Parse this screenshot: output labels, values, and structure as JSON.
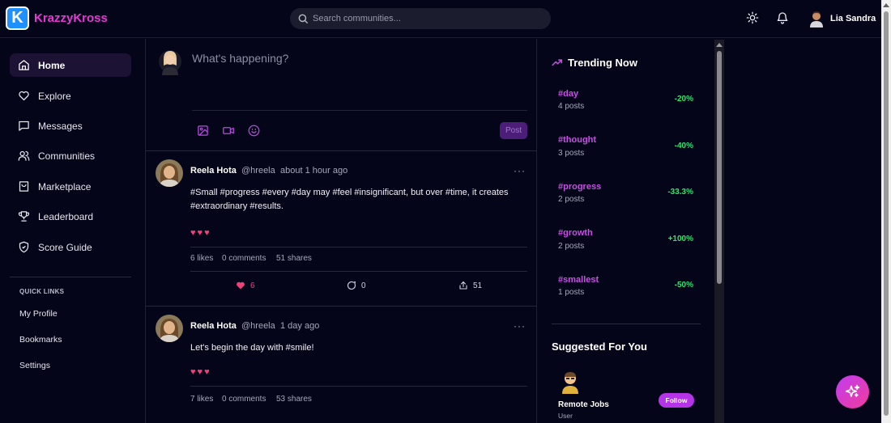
{
  "app": {
    "logo_letter": "K",
    "name": "KrazzyKross",
    "brand_color": "#e43ad4"
  },
  "search": {
    "placeholder": "Search communities..."
  },
  "header": {
    "user_name": "Lia Sandra"
  },
  "nav": {
    "items": [
      {
        "label": "Home",
        "icon": "home-icon",
        "active": true
      },
      {
        "label": "Explore",
        "icon": "heart-icon"
      },
      {
        "label": "Messages",
        "icon": "message-icon"
      },
      {
        "label": "Communities",
        "icon": "users-icon"
      },
      {
        "label": "Marketplace",
        "icon": "shopping-bag-icon"
      },
      {
        "label": "Leaderboard",
        "icon": "trophy-icon"
      },
      {
        "label": "Score Guide",
        "icon": "shield-icon"
      }
    ]
  },
  "quick_links": {
    "title": "QUICK LINKS",
    "items": [
      "My Profile",
      "Bookmarks",
      "Settings"
    ]
  },
  "composer": {
    "placeholder": "What's happening?",
    "post_label": "Post"
  },
  "posts": [
    {
      "author": "Reela Hota",
      "handle": "@hreela",
      "time": "about 1 hour ago",
      "text": "#Small #progress #every #day may #feel #insignificant, but over #time, it creates #extraordinary #results.",
      "reactions": "♥♥♥",
      "likes_text": "6 likes",
      "comments_text": "0 comments",
      "shares_text": "51 shares",
      "likes": "6",
      "comments": "0",
      "shares": "51"
    },
    {
      "author": "Reela Hota",
      "handle": "@hreela",
      "time": "1 day ago",
      "text": "Let's begin the day with #smile!",
      "reactions": "♥♥♥",
      "likes_text": "7 likes",
      "comments_text": "0 comments",
      "shares_text": "53 shares"
    }
  ],
  "trending": {
    "title": "Trending Now",
    "items": [
      {
        "tag": "#day",
        "posts": "4 posts",
        "change": "-20%"
      },
      {
        "tag": "#thought",
        "posts": "3 posts",
        "change": "-40%"
      },
      {
        "tag": "#progress",
        "posts": "2 posts",
        "change": "-33.3%"
      },
      {
        "tag": "#growth",
        "posts": "2 posts",
        "change": "+100%"
      },
      {
        "tag": "#smallest",
        "posts": "1 posts",
        "change": "-50%"
      }
    ]
  },
  "suggested": {
    "title": "Suggested For You",
    "name": "Remote Jobs",
    "role": "User",
    "follow_label": "Follow"
  },
  "colors": {
    "background": "#05051a",
    "accent": "#c451e0",
    "positive": "#2ee66a",
    "like": "#f0417a"
  }
}
